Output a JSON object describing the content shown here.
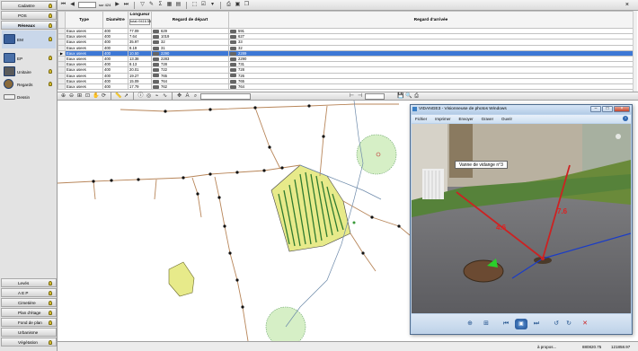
{
  "sidebar": {
    "top": [
      {
        "label": "Cadastre"
      },
      {
        "label": "POS"
      },
      {
        "label": "Réseaux"
      }
    ],
    "network_items": [
      {
        "label": "EM"
      },
      {
        "label": "EP"
      },
      {
        "label": "Unitaire"
      },
      {
        "label": "Regards"
      },
      {
        "label": "Dessin"
      }
    ],
    "bottom": [
      {
        "label": "Levés"
      },
      {
        "label": "A E P"
      },
      {
        "label": "Cimetière"
      },
      {
        "label": "Plan d'étage"
      },
      {
        "label": "Fond de plan"
      },
      {
        "label": "Urbanisme"
      },
      {
        "label": "Végétation"
      }
    ]
  },
  "nav": {
    "record_field": "sur 424"
  },
  "grid": {
    "columns": [
      "Type",
      "Diamètre",
      "Longueur",
      "Regard de départ",
      "Regard d'arrivée"
    ],
    "length_sum": "total=9416.55",
    "rows": [
      {
        "type": "Eaux usees",
        "diam": "400",
        "len": "77.09",
        "dep": "629",
        "arr": "591"
      },
      {
        "type": "Eaux usees",
        "diam": "400",
        "len": "7.64",
        "dep": "1019",
        "arr": "627"
      },
      {
        "type": "Eaux usees",
        "diam": "400",
        "len": "35.97",
        "dep": "32",
        "arr": "33"
      },
      {
        "type": "Eaux usees",
        "diam": "400",
        "len": "8.19",
        "dep": "31",
        "arr": "32"
      },
      {
        "type": "Eaux usees",
        "diam": "400",
        "len": "10.50",
        "dep": "2290",
        "arr": "2289",
        "selected": true
      },
      {
        "type": "Eaux usees",
        "diam": "400",
        "len": "13.38",
        "dep": "2283",
        "arr": "2290"
      },
      {
        "type": "Eaux usees",
        "diam": "400",
        "len": "8.13",
        "dep": "728",
        "arr": "731"
      },
      {
        "type": "Eaux usees",
        "diam": "400",
        "len": "20.01",
        "dep": "722",
        "arr": "728"
      },
      {
        "type": "Eaux usees",
        "diam": "400",
        "len": "19.27",
        "dep": "765",
        "arr": "726"
      },
      {
        "type": "Eaux usees",
        "diam": "400",
        "len": "15.09",
        "dep": "764",
        "arr": "765"
      },
      {
        "type": "Eaux usees",
        "diam": "400",
        "len": "17.79",
        "dep": "762",
        "arr": "764"
      }
    ]
  },
  "viewer": {
    "title": "VIDANGE3 - Visionneuse de photos Windows",
    "menu": [
      "Fichier",
      "Imprimer",
      "Envoyer",
      "Graver",
      "Ouvrir"
    ],
    "photo_label": "Vanne de vidange n°3",
    "distance_1": "4.6",
    "distance_2": "7.6"
  },
  "status": {
    "text": "à propos...",
    "x": "880820.75",
    "y": "121858.97"
  },
  "colors": {
    "selection": "#3d78d6",
    "map_pipe_brown": "#b8865a",
    "map_pipe_blue": "#6d8aaa",
    "parcel_fill": "#e7ea8a",
    "buffer_fill": "#c8e8b8",
    "measure_red": "#cc2222",
    "measure_blue": "#1a3cc8"
  }
}
